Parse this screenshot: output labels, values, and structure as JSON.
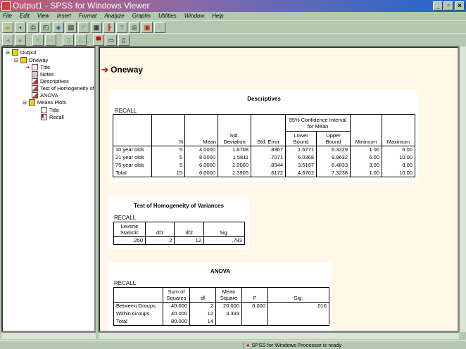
{
  "window": {
    "title": "Output1 - SPSS for Windows Viewer"
  },
  "menu": [
    "File",
    "Edit",
    "View",
    "Insert",
    "Format",
    "Analyze",
    "Graphs",
    "Utilities",
    "Window",
    "Help"
  ],
  "outline": {
    "items": [
      {
        "label": "Output",
        "level": 0
      },
      {
        "label": "Oneway",
        "level": 1
      },
      {
        "label": "Title",
        "level": 2
      },
      {
        "label": "Notes",
        "level": 2
      },
      {
        "label": "Descriptives",
        "level": 2
      },
      {
        "label": "Test of Homogeneity of V",
        "level": 2
      },
      {
        "label": "ANOVA",
        "level": 2
      },
      {
        "label": "Means Plots",
        "level": 2
      },
      {
        "label": "Title",
        "level": 3
      },
      {
        "label": "Recall",
        "level": 3
      }
    ]
  },
  "content": {
    "heading": "Oneway",
    "descriptives": {
      "title": "Descriptives",
      "variable": "RECALL",
      "ci_header": "95% Confidence Interval for Mean",
      "columns": [
        "N",
        "Mean",
        "Std. Deviation",
        "Std. Error",
        "Lower Bound",
        "Upper Bound",
        "Minimum",
        "Maximum"
      ],
      "rows": [
        [
          "10 year olds",
          "5",
          "4.0000",
          "1.8708",
          ".8367",
          "1.6771",
          "6.3229",
          "1.00",
          "6.00"
        ],
        [
          "21 year olds",
          "5",
          "8.0000",
          "1.5811",
          ".7071",
          "6.0368",
          "9.9632",
          "6.00",
          "10.00"
        ],
        [
          "75 year olds",
          "5",
          "6.0000",
          "2.0000",
          ".8944",
          "3.5167",
          "8.4833",
          "3.00",
          "8.00"
        ],
        [
          "Total",
          "15",
          "6.0000",
          "2.3905",
          ".6172",
          "4.6762",
          "7.3238",
          "1.00",
          "10.00"
        ]
      ]
    },
    "homogeneity": {
      "title": "Test of Homogeneity of Variances",
      "variable": "RECALL",
      "columns": [
        "Levene Statistic",
        "df1",
        "df2",
        "Sig."
      ],
      "rows": [
        [
          ".250",
          "2",
          "12",
          ".783"
        ]
      ]
    },
    "anova": {
      "title": "ANOVA",
      "variable": "RECALL",
      "columns": [
        "",
        "Sum of Squares",
        "df",
        "Mean Square",
        "F",
        "Sig."
      ],
      "rows": [
        [
          "Between Groups",
          "40.000",
          "2",
          "20.000",
          "6.000",
          ".016"
        ],
        [
          "Within Groups",
          "40.000",
          "12",
          "3.333",
          "",
          ""
        ],
        [
          "Total",
          "80.000",
          "14",
          "",
          "",
          ""
        ]
      ]
    }
  },
  "status": {
    "text": "SPSS for Windows Processor is ready"
  }
}
